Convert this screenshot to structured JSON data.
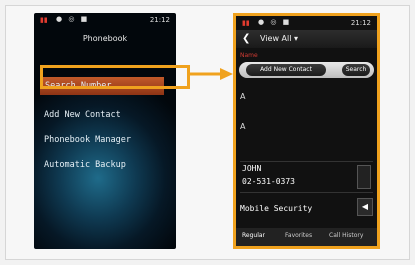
{
  "left_phone": {
    "status": {
      "time": "21:12"
    },
    "title": "Phonebook",
    "menu": [
      {
        "label": "Search Number"
      },
      {
        "label": "Add New Contact"
      },
      {
        "label": "Phonebook Manager"
      },
      {
        "label": "Automatic Backup"
      }
    ]
  },
  "right_phone": {
    "status": {
      "time": "21:12"
    },
    "header": {
      "title": "View All"
    },
    "name_line": "Name",
    "buttons": {
      "add": "Add New Contact",
      "search": "Search"
    },
    "rows": [
      "A",
      "A"
    ],
    "contact": {
      "name": "JOHN",
      "number": "02-531-0373"
    },
    "mobile_security": "Mobile Security",
    "tabs": [
      "Regular",
      "Favorites",
      "Call History"
    ]
  },
  "colors": {
    "highlight": "#f0a21e",
    "selection": "#b14a1e"
  }
}
